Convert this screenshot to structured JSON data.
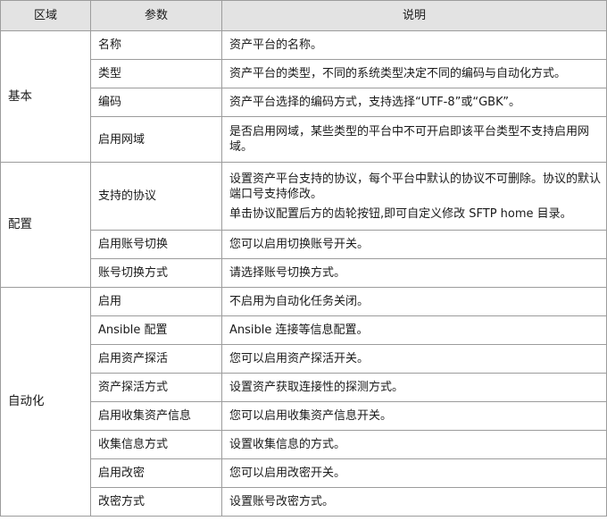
{
  "headers": {
    "area": "区域",
    "param": "参数",
    "desc": "说明"
  },
  "sections": {
    "basic": {
      "area": "基本",
      "rows": [
        {
          "param": "名称",
          "desc": "资产平台的名称。"
        },
        {
          "param": "类型",
          "desc": "资产平台的类型，不同的系统类型决定不同的编码与自动化方式。"
        },
        {
          "param": "编码",
          "desc": "资产平台选择的编码方式，支持选择“UTF-8”或“GBK”。"
        },
        {
          "param": "启用网域",
          "desc": "是否启用网域，某些类型的平台中不可开启即该平台类型不支持启用网域。"
        }
      ]
    },
    "config": {
      "area": "配置",
      "rows": [
        {
          "param": "支持的协议",
          "desc": "设置资产平台支持的协议，每个平台中默认的协议不可删除。协议的默认端口号支持修改。",
          "desc2": "单击协议配置后方的齿轮按钮,即可自定义修改 SFTP home 目录。"
        },
        {
          "param": "启用账号切换",
          "desc": "您可以启用切换账号开关。"
        },
        {
          "param": "账号切换方式",
          "desc": "请选择账号切换方式。"
        }
      ]
    },
    "automation": {
      "area": "自动化",
      "rows": [
        {
          "param": "启用",
          "desc": "不启用为自动化任务关闭。"
        },
        {
          "param": "Ansible 配置",
          "desc": "Ansible 连接等信息配置。"
        },
        {
          "param": "启用资产探活",
          "desc": "您可以启用资产探活开关。"
        },
        {
          "param": "资产探活方式",
          "desc": "设置资产获取连接性的探测方式。"
        },
        {
          "param": "启用收集资产信息",
          "desc": "您可以启用收集资产信息开关。"
        },
        {
          "param": "收集信息方式",
          "desc": "设置收集信息的方式。"
        },
        {
          "param": "启用改密",
          "desc": "您可以启用改密开关。"
        },
        {
          "param": "改密方式",
          "desc": "设置账号改密方式。"
        }
      ]
    }
  }
}
